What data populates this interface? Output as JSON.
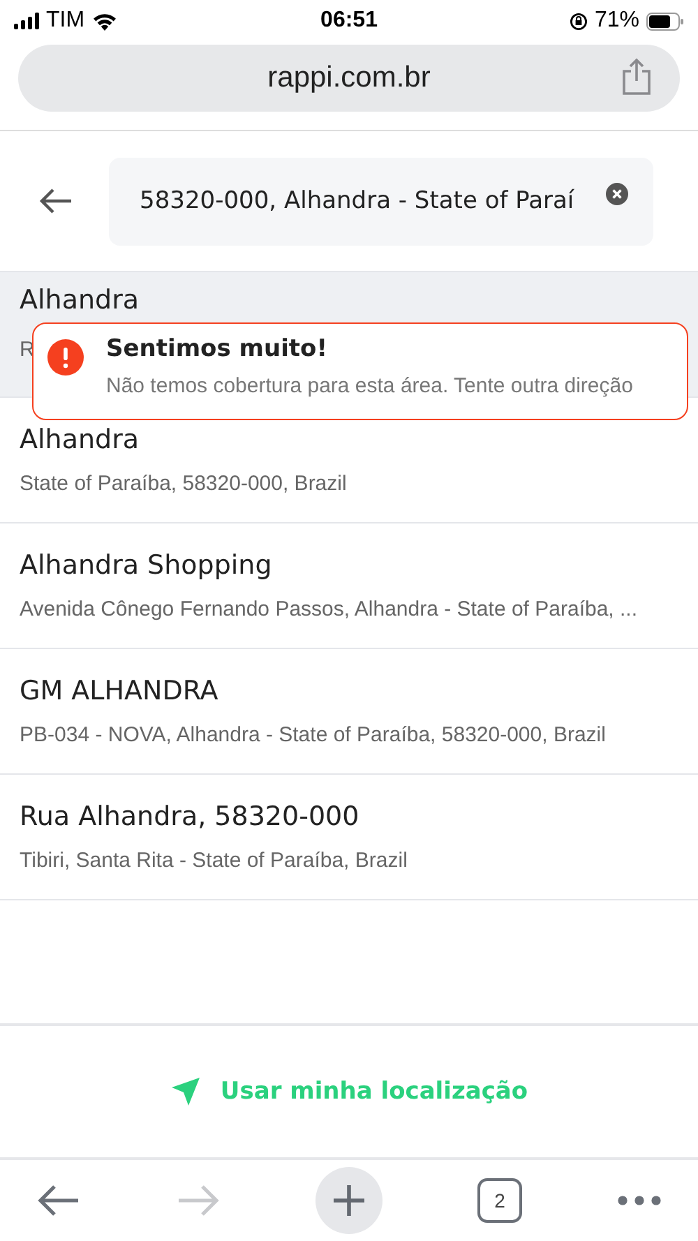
{
  "status_bar": {
    "carrier": "TIM",
    "time": "06:51",
    "battery": "71%"
  },
  "url_bar": {
    "url": "rappi.com.br"
  },
  "search": {
    "value": "58320-000, Alhandra - State of Paraí"
  },
  "results": [
    {
      "title": "Alhandra",
      "subtitle": "R",
      "selected": true
    },
    {
      "title": "Alhandra",
      "subtitle": "State of Paraíba, 58320-000, Brazil",
      "selected": false
    },
    {
      "title": "Alhandra Shopping",
      "subtitle": "Avenida Cônego Fernando Passos, Alhandra - State of Paraíba, ...",
      "selected": false
    },
    {
      "title": "GM ALHANDRA",
      "subtitle": "PB-034 - NOVA, Alhandra - State of Paraíba, 58320-000, Brazil",
      "selected": false
    },
    {
      "title": "Rua Alhandra, 58320-000",
      "subtitle": "Tibiri, Santa Rita - State of Paraíba, Brazil",
      "selected": false
    }
  ],
  "toast": {
    "title": "Sentimos muito!",
    "message": "Não temos cobertura para esta área. Tente outra direção"
  },
  "location_button": {
    "label": "Usar minha localização"
  },
  "browser_toolbar": {
    "back_disabled": false,
    "forward_disabled": true,
    "tab_count": "2"
  }
}
